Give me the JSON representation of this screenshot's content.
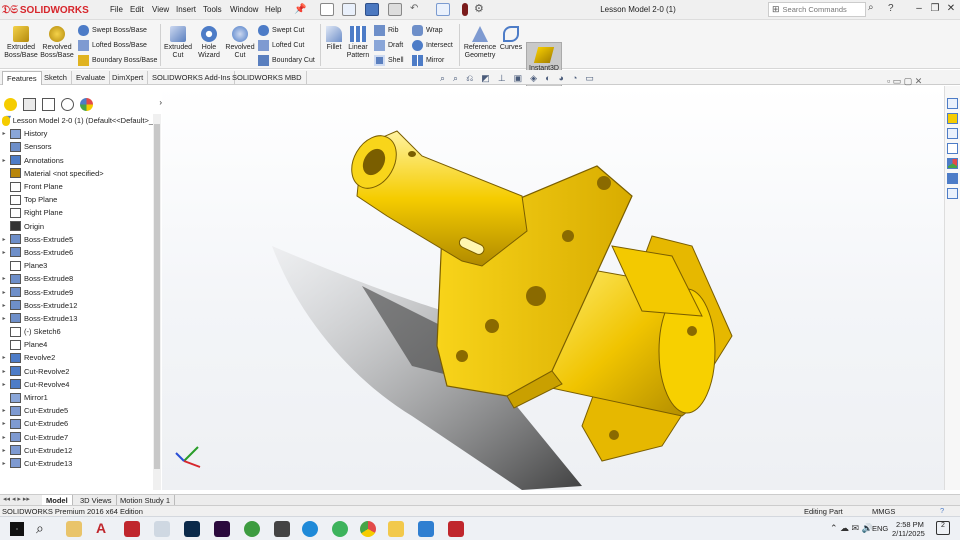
{
  "app": {
    "brand": "SOLIDWORKS",
    "document_title": "Lesson Model 2-0 (1)"
  },
  "menu": [
    "File",
    "Edit",
    "View",
    "Insert",
    "Tools",
    "Window",
    "Help"
  ],
  "search": {
    "placeholder": "Search Commands"
  },
  "ribbon": {
    "extruded_boss": "Extruded\nBoss/Base",
    "revolved_boss": "Revolved\nBoss/Base",
    "swept_boss": "Swept Boss/Base",
    "lofted_boss": "Lofted Boss/Base",
    "boundary_boss": "Boundary Boss/Base",
    "extruded_cut": "Extruded\nCut",
    "hole_wizard": "Hole\nWizard",
    "revolved_cut": "Revolved\nCut",
    "swept_cut": "Swept Cut",
    "lofted_cut": "Lofted Cut",
    "boundary_cut": "Boundary Cut",
    "fillet": "Fillet",
    "linear_pattern": "Linear\nPattern",
    "rib": "Rib",
    "draft": "Draft",
    "shell": "Shell",
    "wrap": "Wrap",
    "intersect": "Intersect",
    "mirror": "Mirror",
    "reference_geometry": "Reference\nGeometry",
    "curves": "Curves",
    "instant3d": "Instant3D"
  },
  "command_tabs": [
    "Features",
    "Sketch",
    "Evaluate",
    "DimXpert",
    "SOLIDWORKS Add-Ins",
    "SOLIDWORKS MBD"
  ],
  "tree": {
    "root": "Lesson Model 2-0 (1)  (Default<<Default>_",
    "items": [
      {
        "label": "History",
        "arrow": "▸",
        "icon": "history-icon"
      },
      {
        "label": "Sensors",
        "arrow": "",
        "icon": "sensors-icon"
      },
      {
        "label": "Annotations",
        "arrow": "▸",
        "icon": "annotations-icon"
      },
      {
        "label": "Material <not specified>",
        "arrow": "",
        "icon": "material-icon"
      },
      {
        "label": "Front Plane",
        "arrow": "",
        "icon": "plane-icon"
      },
      {
        "label": "Top Plane",
        "arrow": "",
        "icon": "plane-icon"
      },
      {
        "label": "Right Plane",
        "arrow": "",
        "icon": "plane-icon"
      },
      {
        "label": "Origin",
        "arrow": "",
        "icon": "origin-icon"
      },
      {
        "label": "Boss-Extrude5",
        "arrow": "▸",
        "icon": "extrude-icon"
      },
      {
        "label": "Boss-Extrude6",
        "arrow": "▸",
        "icon": "extrude-icon"
      },
      {
        "label": "Plane3",
        "arrow": "",
        "icon": "plane-icon"
      },
      {
        "label": "Boss-Extrude8",
        "arrow": "▸",
        "icon": "extrude-icon"
      },
      {
        "label": "Boss-Extrude9",
        "arrow": "▸",
        "icon": "extrude-icon"
      },
      {
        "label": "Boss-Extrude12",
        "arrow": "▸",
        "icon": "extrude-icon"
      },
      {
        "label": "Boss-Extrude13",
        "arrow": "▸",
        "icon": "extrude-icon"
      },
      {
        "label": "(-) Sketch6",
        "arrow": "",
        "icon": "sketch-icon"
      },
      {
        "label": "Plane4",
        "arrow": "",
        "icon": "plane-icon"
      },
      {
        "label": "Revolve2",
        "arrow": "▸",
        "icon": "revolve-icon"
      },
      {
        "label": "Cut-Revolve2",
        "arrow": "▸",
        "icon": "revolve-icon"
      },
      {
        "label": "Cut-Revolve4",
        "arrow": "▸",
        "icon": "revolve-icon"
      },
      {
        "label": "Mirror1",
        "arrow": "",
        "icon": "mirror-icon"
      },
      {
        "label": "Cut-Extrude5",
        "arrow": "▸",
        "icon": "cut-icon"
      },
      {
        "label": "Cut-Extrude6",
        "arrow": "▸",
        "icon": "cut-icon"
      },
      {
        "label": "Cut-Extrude7",
        "arrow": "▸",
        "icon": "cut-icon"
      },
      {
        "label": "Cut-Extrude12",
        "arrow": "▸",
        "icon": "cut-icon"
      },
      {
        "label": "Cut-Extrude13",
        "arrow": "▸",
        "icon": "cut-icon"
      }
    ]
  },
  "bottom_tabs": [
    "Model",
    "3D Views",
    "Motion Study 1"
  ],
  "status": {
    "left": "SOLIDWORKS Premium 2016 x64 Edition",
    "mode": "Editing Part",
    "units": "MMGS"
  },
  "taskbar": {
    "lang": "ENG",
    "time": "2:58 PM",
    "date": "2/11/2025",
    "notifications": "2"
  },
  "colors": {
    "accent": "#d7262c",
    "part": "#f5cc00",
    "instant3d_bg": "#c9c9c9"
  }
}
